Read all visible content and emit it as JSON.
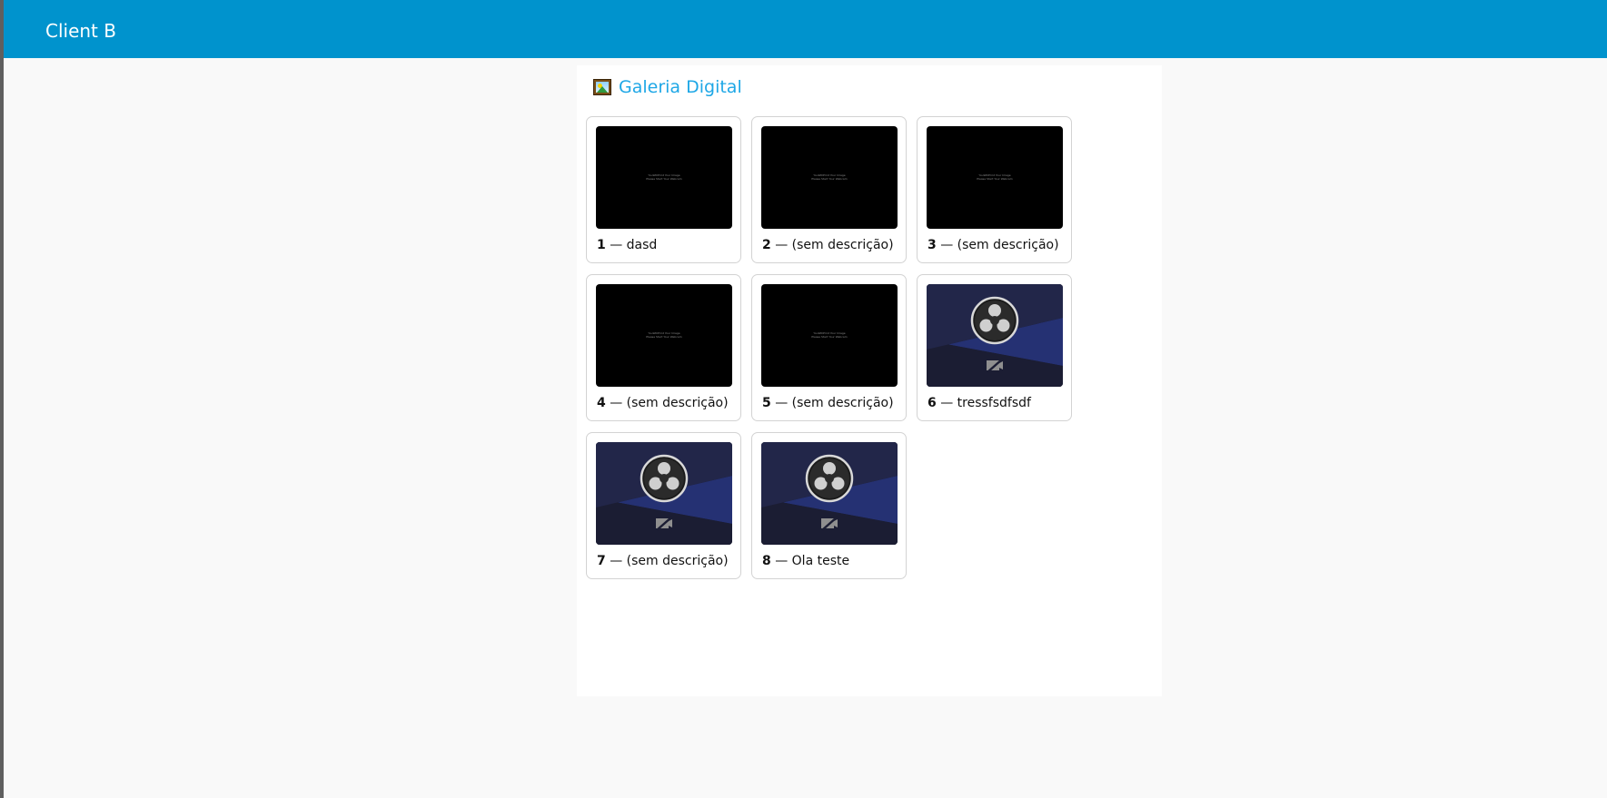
{
  "app": {
    "title": "Client B"
  },
  "gallery": {
    "icon": "framed-picture-icon",
    "title": "Galeria Digital",
    "separator": " — ",
    "items": [
      {
        "number": "1",
        "description": "dasd",
        "thumb": "black",
        "thumb_text": [
          "YouWillPrint Your Image",
          "Please Start Your Webcam"
        ]
      },
      {
        "number": "2",
        "description": "(sem descrição)",
        "thumb": "black",
        "thumb_text": [
          "YouWillPrint Your Image",
          "Please Start Your Webcam"
        ]
      },
      {
        "number": "3",
        "description": "(sem descrição)",
        "thumb": "black",
        "thumb_text": [
          "YouWillPrint Your Image",
          "Please Start Your Webcam"
        ]
      },
      {
        "number": "4",
        "description": "(sem descrição)",
        "thumb": "black",
        "thumb_text": [
          "YouWillPrint Your Image",
          "Please Start Your Webcam"
        ]
      },
      {
        "number": "5",
        "description": "(sem descrição)",
        "thumb": "black",
        "thumb_text": [
          "YouWillPrint Your Image",
          "Please Start Your Webcam"
        ]
      },
      {
        "number": "6",
        "description": "tressfsdfsdf",
        "thumb": "obs"
      },
      {
        "number": "7",
        "description": "(sem descrição)",
        "thumb": "obs"
      },
      {
        "number": "8",
        "description": "Ola teste",
        "thumb": "obs"
      }
    ]
  },
  "colors": {
    "titlebar": "#0093cd",
    "gallery_title": "#1ea7e6",
    "obs_dark": "#1b1d33",
    "obs_band": "#253173"
  }
}
